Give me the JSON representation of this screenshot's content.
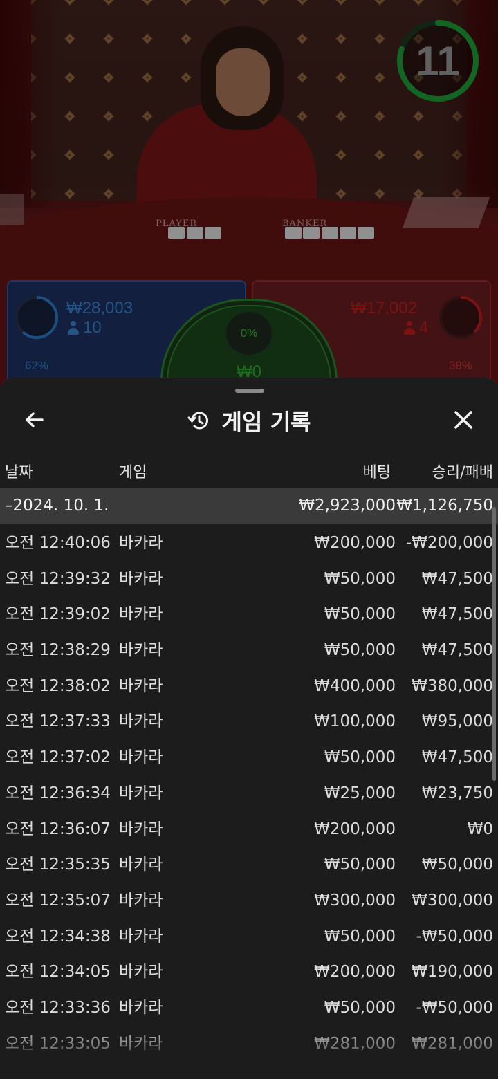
{
  "video": {
    "table_labels": {
      "player": "PLAYER",
      "banker": "BANKER"
    },
    "timer": {
      "value": "11",
      "progress": 0.8,
      "color": "#1fa33a"
    }
  },
  "bets": {
    "player": {
      "percent": "62%",
      "percent_value": 0.62,
      "amount": "₩28,003",
      "players": "10",
      "color": "#2f7fd0"
    },
    "tie": {
      "percent": "0%",
      "amount": "₩0",
      "color": "#2fb32f"
    },
    "banker": {
      "percent": "38%",
      "percent_value": 0.38,
      "amount": "₩17,002",
      "players": "4",
      "color": "#c81e1e"
    }
  },
  "sheet": {
    "title": "게임 기록",
    "icons": {
      "back": "arrow-left-icon",
      "history": "history-icon",
      "close": "close-icon"
    },
    "columns": {
      "date": "날짜",
      "game": "게임",
      "bet": "베팅",
      "win_loss": "승리/패배"
    },
    "date_group": {
      "label": "–2024. 10. 1.",
      "total_bet": "₩2,923,000",
      "total_result": "₩1,126,750"
    },
    "rows": [
      {
        "time": "오전 12:40:06",
        "game": "바카라",
        "bet": "₩200,000",
        "result": "-₩200,000"
      },
      {
        "time": "오전 12:39:32",
        "game": "바카라",
        "bet": "₩50,000",
        "result": "₩47,500"
      },
      {
        "time": "오전 12:39:02",
        "game": "바카라",
        "bet": "₩50,000",
        "result": "₩47,500"
      },
      {
        "time": "오전 12:38:29",
        "game": "바카라",
        "bet": "₩50,000",
        "result": "₩47,500"
      },
      {
        "time": "오전 12:38:02",
        "game": "바카라",
        "bet": "₩400,000",
        "result": "₩380,000"
      },
      {
        "time": "오전 12:37:33",
        "game": "바카라",
        "bet": "₩100,000",
        "result": "₩95,000"
      },
      {
        "time": "오전 12:37:02",
        "game": "바카라",
        "bet": "₩50,000",
        "result": "₩47,500"
      },
      {
        "time": "오전 12:36:34",
        "game": "바카라",
        "bet": "₩25,000",
        "result": "₩23,750"
      },
      {
        "time": "오전 12:36:07",
        "game": "바카라",
        "bet": "₩200,000",
        "result": "₩0"
      },
      {
        "time": "오전 12:35:35",
        "game": "바카라",
        "bet": "₩50,000",
        "result": "₩50,000"
      },
      {
        "time": "오전 12:35:07",
        "game": "바카라",
        "bet": "₩300,000",
        "result": "₩300,000"
      },
      {
        "time": "오전 12:34:38",
        "game": "바카라",
        "bet": "₩50,000",
        "result": "-₩50,000"
      },
      {
        "time": "오전 12:34:05",
        "game": "바카라",
        "bet": "₩200,000",
        "result": "₩190,000"
      },
      {
        "time": "오전 12:33:36",
        "game": "바카라",
        "bet": "₩50,000",
        "result": "-₩50,000"
      },
      {
        "time": "오전 12:33:05",
        "game": "바카라",
        "bet": "₩281,000",
        "result": "₩281,000"
      }
    ]
  }
}
